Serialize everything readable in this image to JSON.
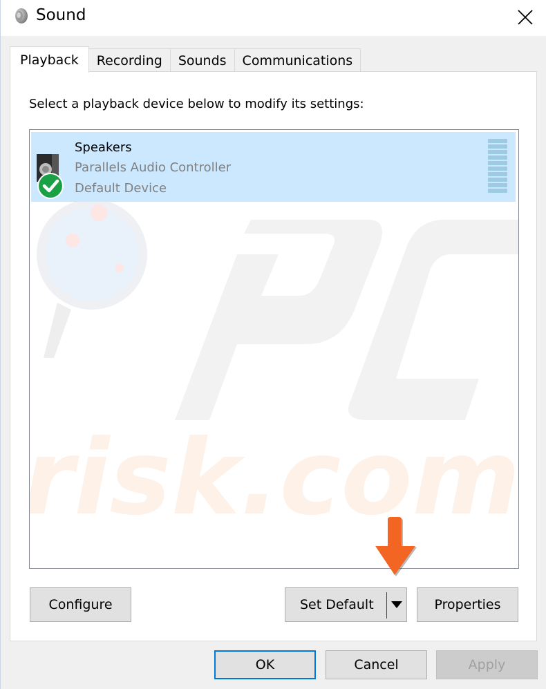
{
  "window": {
    "title": "Sound",
    "icon": "speaker-icon",
    "close_icon": "close-icon"
  },
  "tabs": [
    {
      "label": "Playback",
      "active": true
    },
    {
      "label": "Recording",
      "active": false
    },
    {
      "label": "Sounds",
      "active": false
    },
    {
      "label": "Communications",
      "active": false
    }
  ],
  "playback": {
    "instruction": "Select a playback device below to modify its settings:",
    "devices": [
      {
        "name": "Speakers",
        "controller": "Parallels Audio Controller",
        "status": "Default Device",
        "selected": true,
        "icon": "speaker-device-icon",
        "badge_icon": "default-check-icon",
        "level_meter_bars": 10
      }
    ],
    "buttons": {
      "configure": "Configure",
      "set_default": "Set Default",
      "set_default_dropdown_icon": "dropdown-arrow-icon",
      "properties": "Properties"
    }
  },
  "footer": {
    "ok": "OK",
    "cancel": "Cancel",
    "apply": "Apply",
    "apply_enabled": false
  },
  "annotation": {
    "arrow_icon": "orange-down-arrow-icon",
    "arrow_color": "#f26522",
    "points_to": "Set Default"
  },
  "watermark": {
    "text": "pcrisk.com"
  },
  "colors": {
    "selection": "#cce8ff",
    "accent": "#0078d7",
    "check_green": "#1ba145"
  }
}
